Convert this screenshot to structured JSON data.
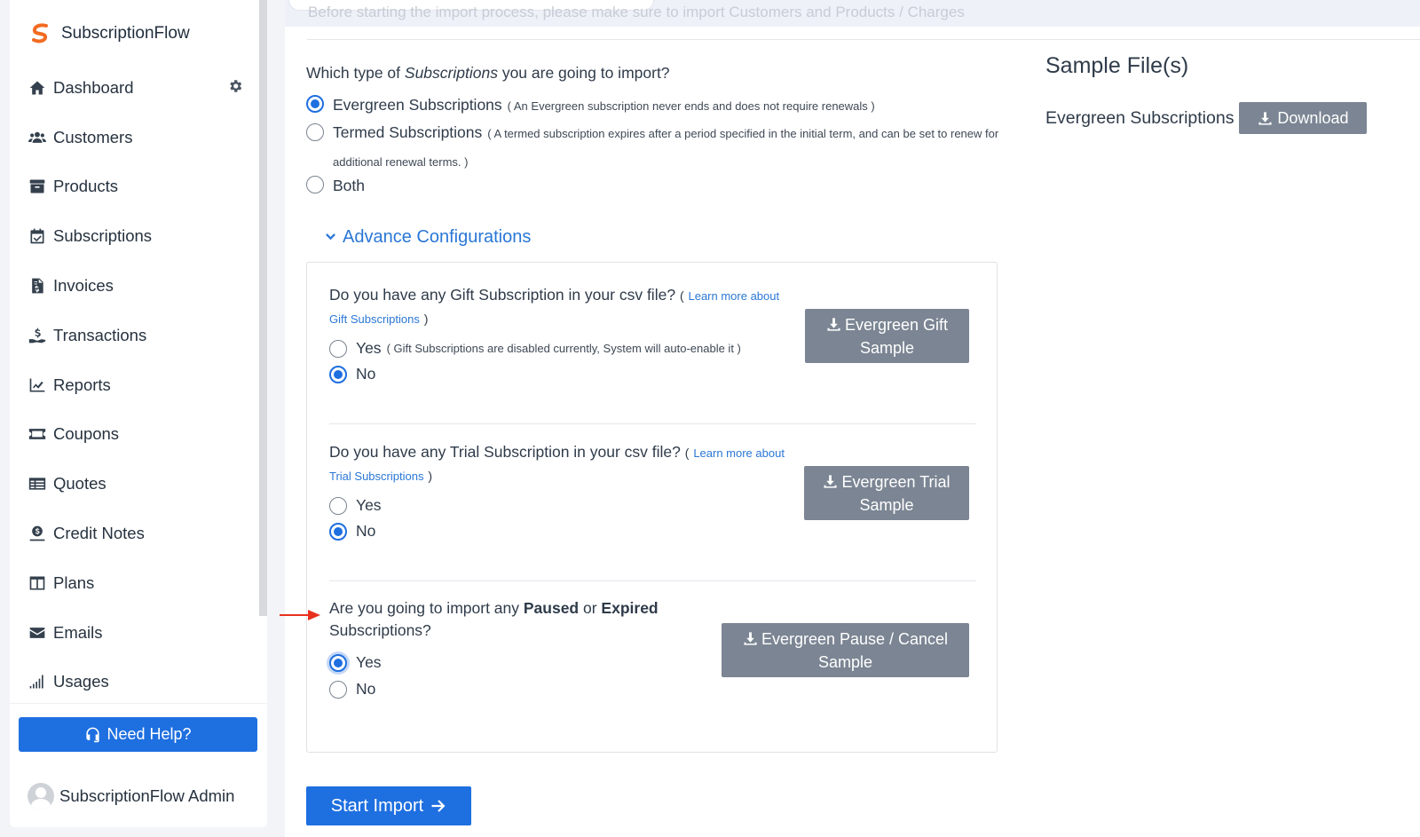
{
  "app": {
    "name": "SubscriptionFlow"
  },
  "sidebar": {
    "items": [
      {
        "label": "Dashboard",
        "icon": "home-icon"
      },
      {
        "label": "Customers",
        "icon": "users-icon"
      },
      {
        "label": "Products",
        "icon": "archive-icon"
      },
      {
        "label": "Subscriptions",
        "icon": "calendar-check-icon"
      },
      {
        "label": "Invoices",
        "icon": "invoice-icon"
      },
      {
        "label": "Transactions",
        "icon": "hand-dollar-icon"
      },
      {
        "label": "Reports",
        "icon": "line-chart-icon"
      },
      {
        "label": "Coupons",
        "icon": "ticket-icon"
      },
      {
        "label": "Quotes",
        "icon": "list-icon"
      },
      {
        "label": "Credit Notes",
        "icon": "dollar-user-icon"
      },
      {
        "label": "Plans",
        "icon": "columns-icon"
      },
      {
        "label": "Emails",
        "icon": "envelope-icon"
      },
      {
        "label": "Usages",
        "icon": "signal-icon"
      }
    ],
    "help_label": "Need Help?",
    "user_name": "SubscriptionFlow Admin"
  },
  "top": {
    "faded_text": "Before starting the import process, please make sure to import Customers and Products / Charges"
  },
  "import": {
    "question_prefix": "Which type of ",
    "question_em": "Subscriptions",
    "question_suffix": " you are going to import?",
    "options": [
      {
        "label": "Evergreen Subscriptions",
        "hint": "( An Evergreen subscription never ends and does not require renewals )",
        "checked": true
      },
      {
        "label": "Termed Subscriptions",
        "hint": "( A termed subscription expires after a period specified in the initial term, and can be set to renew for additional renewal terms. )",
        "checked": false
      },
      {
        "label": "Both",
        "hint": "",
        "checked": false
      }
    ]
  },
  "advance": {
    "title": "Advance Configurations",
    "gift": {
      "question": "Do you have any Gift Subscription in your csv file?",
      "learn_open": "(",
      "learn_link": "Learn more about Gift Subscriptions",
      "learn_close": ")",
      "yes_label": "Yes",
      "yes_hint": "( Gift Subscriptions are disabled currently, System will auto-enable it )",
      "no_label": "No",
      "selected": "No",
      "button_label": "Evergreen Gift Sample"
    },
    "trial": {
      "question": "Do you have any Trial Subscription in your csv file?",
      "learn_open": "(",
      "learn_link": "Learn more about Trial Subscriptions",
      "learn_close": ")",
      "yes_label": "Yes",
      "no_label": "No",
      "selected": "No",
      "button_label": "Evergreen Trial Sample"
    },
    "paused": {
      "q_part1": "Are you going to import any ",
      "q_bold1": "Paused",
      "q_part2": " or ",
      "q_bold2": "Expired",
      "q_part3": " Subscriptions?",
      "yes_label": "Yes",
      "no_label": "No",
      "selected": "Yes",
      "button_label": "Evergreen Pause / Cancel Sample"
    }
  },
  "actions": {
    "start_label": "Start Import"
  },
  "samples": {
    "title": "Sample File(s)",
    "label": "Evergreen Subscriptions",
    "download_label": "Download"
  },
  "colors": {
    "primary": "#1e6fe0",
    "secondary_button": "#7b8593",
    "link": "#2a77d6",
    "annotation_arrow": "#e8321e"
  }
}
